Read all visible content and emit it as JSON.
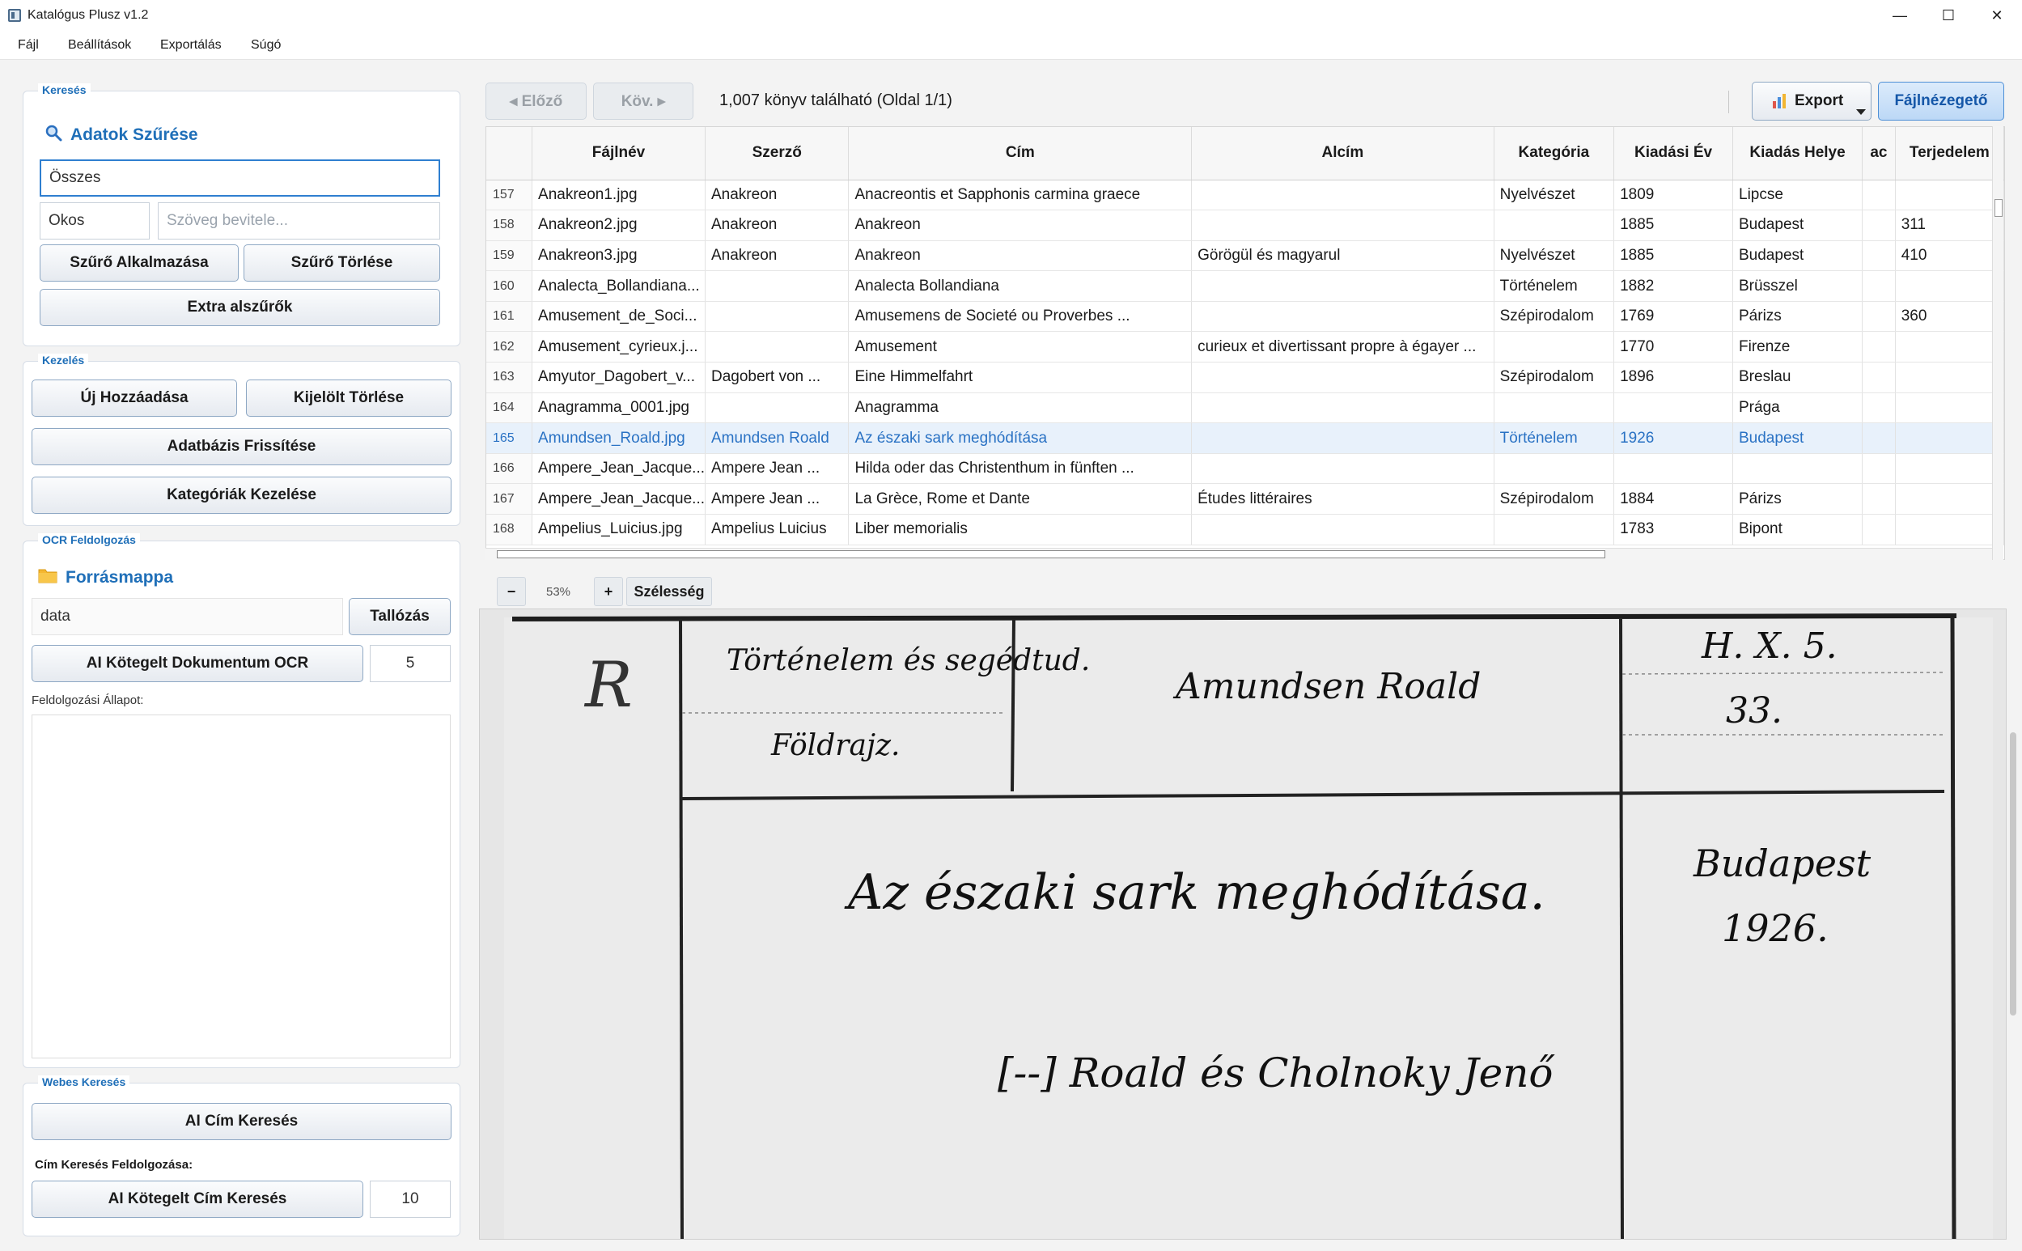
{
  "window": {
    "title": "Katalógus Plusz v1.2",
    "minimize": "—",
    "maximize": "☐",
    "close": "✕"
  },
  "menu": [
    "Fájl",
    "Beállítások",
    "Exportálás",
    "Súgó"
  ],
  "search": {
    "group_title": "Keresés",
    "header": "Adatok Szűrése",
    "scope_value": "Összes",
    "mode_value": "Okos",
    "text_placeholder": "Szöveg bevitele...",
    "apply_label": "Szűrő Alkalmazása",
    "clear_label": "Szűrő Törlése",
    "extra_label": "Extra alszűrők"
  },
  "manage": {
    "group_title": "Kezelés",
    "add_label": "Új Hozzáadása",
    "delete_label": "Kijelölt Törlése",
    "refresh_label": "Adatbázis Frissítése",
    "categories_label": "Kategóriák Kezelése"
  },
  "ocr": {
    "group_title": "OCR Feldolgozás",
    "header": "Forrásmappa",
    "folder_value": "data",
    "browse_label": "Tallózás",
    "batch_label": "AI Kötegelt Dokumentum OCR",
    "batch_count": "5",
    "status_label": "Feldolgozási Állapot:"
  },
  "web": {
    "group_title": "Webes Keresés",
    "title_search_label": "AI Cím Keresés",
    "processing_label": "Cím Keresés Feldolgozása:",
    "batch_title_label": "AI Kötegelt Cím Keresés",
    "batch_count": "10"
  },
  "toolbar": {
    "prev_label": "◂ Előző",
    "next_label": "Köv. ▸",
    "status": "1,007 könyv található (Oldal 1/1)",
    "export_label": "Export",
    "viewer_label": "Fájlnézegető"
  },
  "table": {
    "columns": [
      "",
      "Fájlnév",
      "Szerző",
      "Cím",
      "Alcím",
      "Kategória",
      "Kiadási Év",
      "Kiadás Helye",
      "ac",
      "Terjedelem"
    ],
    "selected_row": 8,
    "rows": [
      [
        "157",
        "Anakreon1.jpg",
        "Anakreon",
        "Anacreontis et Sapphonis carmina graece",
        "",
        "Nyelvészet",
        "1809",
        "Lipcse",
        "",
        ""
      ],
      [
        "158",
        "Anakreon2.jpg",
        "Anakreon",
        "Anakreon",
        "",
        "",
        "1885",
        "Budapest",
        "",
        "311"
      ],
      [
        "159",
        "Anakreon3.jpg",
        "Anakreon",
        "Anakreon",
        "Görögül és magyarul",
        "Nyelvészet",
        "1885",
        "Budapest",
        "",
        "410"
      ],
      [
        "160",
        "Analecta_Bollandiana...",
        "",
        "Analecta Bollandiana",
        "",
        "Történelem",
        "1882",
        "Brüsszel",
        "",
        ""
      ],
      [
        "161",
        "Amusement_de_Soci...",
        "",
        "Amusemens de Societé ou Proverbes ...",
        "",
        "Szépirodalom",
        "1769",
        "Párizs",
        "",
        "360"
      ],
      [
        "162",
        "Amusement_cyrieux.j...",
        "",
        "Amusement",
        "curieux et divertissant propre à égayer ...",
        "",
        "1770",
        "Firenze",
        "",
        ""
      ],
      [
        "163",
        "Amyutor_Dagobert_v...",
        "Dagobert von ...",
        "Eine Himmelfahrt",
        "",
        "Szépirodalom",
        "1896",
        "Breslau",
        "",
        ""
      ],
      [
        "164",
        "Anagramma_0001.jpg",
        "",
        "Anagramma",
        "",
        "",
        "",
        "Prága",
        "",
        ""
      ],
      [
        "165",
        "Amundsen_Roald.jpg",
        "Amundsen Roald",
        "Az északi sark meghódítása",
        "",
        "Történelem",
        "1926",
        "Budapest",
        "",
        ""
      ],
      [
        "166",
        "Ampere_Jean_Jacque...",
        "Ampere Jean ...",
        "Hilda oder das Christenthum in fünften ...",
        "",
        "",
        "",
        "",
        "",
        ""
      ],
      [
        "167",
        "Ampere_Jean_Jacque...",
        "Ampere Jean ...",
        "La Grèce, Rome et Dante",
        "Études littéraires",
        "Szépirodalom",
        "1884",
        "Párizs",
        "",
        ""
      ],
      [
        "168",
        "Ampelius_Luicius.jpg",
        "Ampelius Luicius",
        "Liber memorialis",
        "",
        "",
        "1783",
        "Bipont",
        "",
        ""
      ]
    ]
  },
  "zoom": {
    "minus_label": "−",
    "level": "53%",
    "plus_label": "+",
    "width_label": "Szélesség"
  },
  "scan": {
    "mark_top_left": "R",
    "category_line1": "Történelem és segédtud.",
    "category_line2": "Földrajz.",
    "author": "Amundsen Roald",
    "shelfmark_line1": "H. X. 5.",
    "shelfmark_line2": "33.",
    "title": "Az északi sark meghódítása.",
    "place": "Budapest",
    "year": "1926.",
    "translator": "[--] Roald és Cholnoky Jenő"
  },
  "icons": {
    "search": "magnifier-icon",
    "folder": "folder-icon",
    "export": "bar-chart-icon",
    "dropdown": "triangle-down-icon"
  }
}
